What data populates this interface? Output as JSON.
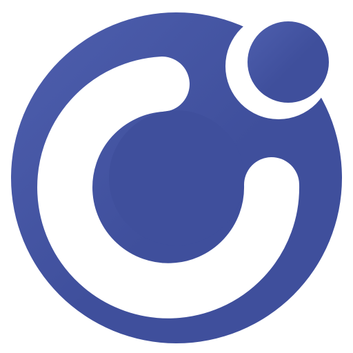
{
  "logo": {
    "icon": "circular-c-logo-icon",
    "colors": {
      "primary": "#3F4F9C",
      "highlight": "#4E5FAE",
      "background": "#FFFFFF"
    }
  }
}
